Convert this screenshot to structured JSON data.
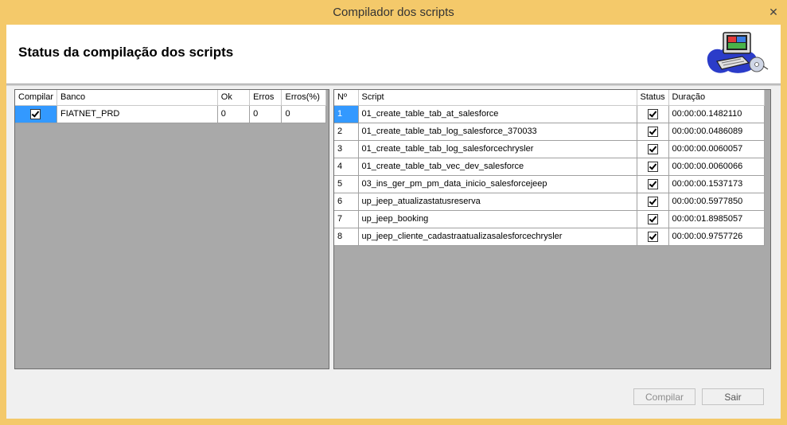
{
  "window": {
    "title": "Compilador dos scripts",
    "close_glyph": "✕"
  },
  "header": {
    "title": "Status da compilação dos scripts",
    "logo_icon": "computer-cd-icon"
  },
  "banco_grid": {
    "headers": [
      "Compilar",
      "Banco",
      "Ok",
      "Erros",
      "Erros(%)"
    ],
    "rows": [
      {
        "compilar": true,
        "banco": "FIATNET_PRD",
        "ok": "0",
        "erros": "0",
        "erros_pct": "0"
      }
    ]
  },
  "script_grid": {
    "headers": [
      "Nº",
      "Script",
      "Status",
      "Duração"
    ],
    "rows": [
      {
        "n": "1",
        "script": "01_create_table_tab_at_salesforce",
        "status": true,
        "duracao": "00:00:00.1482110"
      },
      {
        "n": "2",
        "script": "01_create_table_tab_log_salesforce_370033",
        "status": true,
        "duracao": "00:00:00.0486089"
      },
      {
        "n": "3",
        "script": "01_create_table_tab_log_salesforcechrysler",
        "status": true,
        "duracao": "00:00:00.0060057"
      },
      {
        "n": "4",
        "script": "01_create_table_tab_vec_dev_salesforce",
        "status": true,
        "duracao": "00:00:00.0060066"
      },
      {
        "n": "5",
        "script": "03_ins_ger_pm_pm_data_inicio_salesforcejeep",
        "status": true,
        "duracao": "00:00:00.1537173"
      },
      {
        "n": "6",
        "script": "up_jeep_atualizastatusreserva",
        "status": true,
        "duracao": "00:00:00.5977850"
      },
      {
        "n": "7",
        "script": "up_jeep_booking",
        "status": true,
        "duracao": "00:00:01.8985057"
      },
      {
        "n": "8",
        "script": "up_jeep_cliente_cadastraatualizasalesforcechrysler",
        "status": true,
        "duracao": "00:00:00.9757726"
      }
    ]
  },
  "buttons": {
    "compilar": "Compilar",
    "sair": "Sair"
  },
  "colors": {
    "frame": "#f4c96a",
    "selection": "#3399ff",
    "grid_bg": "#a9a9a9"
  }
}
